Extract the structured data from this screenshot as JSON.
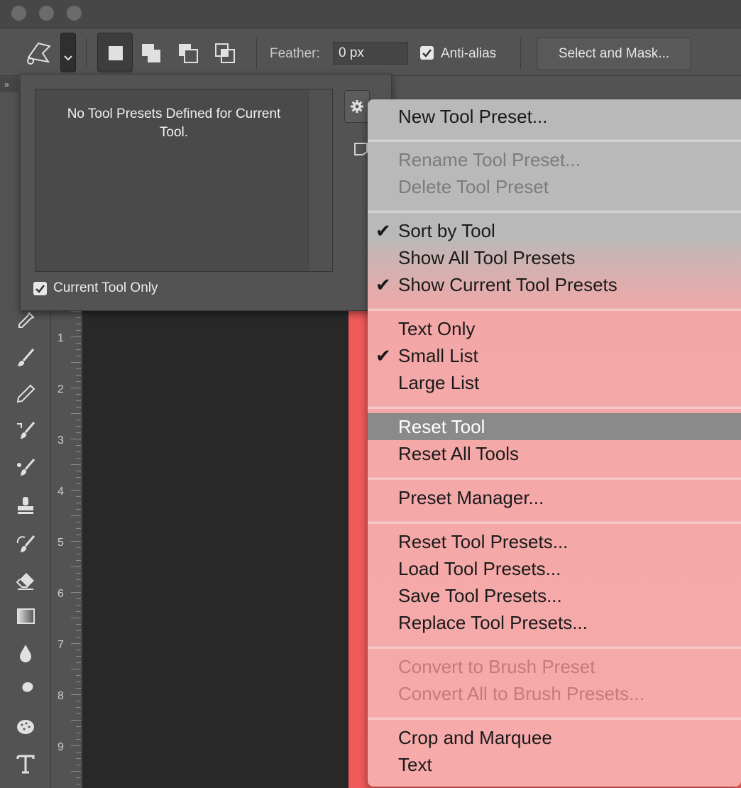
{
  "options_bar": {
    "feather_label": "Feather:",
    "feather_value": "0 px",
    "antialias_label": "Anti-alias",
    "select_mask_label": "Select and Mask..."
  },
  "tool_presets": {
    "empty_message": "No Tool Presets Defined for Current Tool.",
    "current_tool_only_label": "Current Tool Only",
    "current_tool_only_checked": true
  },
  "ruler": {
    "numbers": [
      "1",
      "2",
      "3",
      "4",
      "5",
      "6",
      "7",
      "8",
      "9"
    ]
  },
  "menu": {
    "items": [
      {
        "label": "New Tool Preset...",
        "state": "enabled"
      },
      {
        "label": "Rename Tool Preset...",
        "state": "disabled"
      },
      {
        "label": "Delete Tool Preset",
        "state": "disabled"
      },
      {
        "label": "Sort by Tool",
        "state": "enabled",
        "checked": true
      },
      {
        "label": "Show All Tool Presets",
        "state": "enabled"
      },
      {
        "label": "Show Current Tool Presets",
        "state": "enabled",
        "checked": true
      },
      {
        "label": "Text Only",
        "state": "enabled"
      },
      {
        "label": "Small List",
        "state": "enabled",
        "checked": true
      },
      {
        "label": "Large List",
        "state": "enabled"
      },
      {
        "label": "Reset Tool",
        "state": "highlighted"
      },
      {
        "label": "Reset All Tools",
        "state": "enabled"
      },
      {
        "label": "Preset Manager...",
        "state": "enabled"
      },
      {
        "label": "Reset Tool Presets...",
        "state": "enabled"
      },
      {
        "label": "Load Tool Presets...",
        "state": "enabled"
      },
      {
        "label": "Save Tool Presets...",
        "state": "enabled"
      },
      {
        "label": "Replace Tool Presets...",
        "state": "enabled"
      },
      {
        "label": "Convert to Brush Preset",
        "state": "disabled"
      },
      {
        "label": "Convert All to Brush Presets...",
        "state": "disabled"
      },
      {
        "label": "Crop and Marquee",
        "state": "enabled"
      },
      {
        "label": "Text",
        "state": "enabled"
      }
    ],
    "check_glyph": "✔"
  },
  "colors": {
    "ui_gray": "#535353",
    "canvas_red": "#f15a5a",
    "menu_highlight": "#8a8a8a"
  }
}
